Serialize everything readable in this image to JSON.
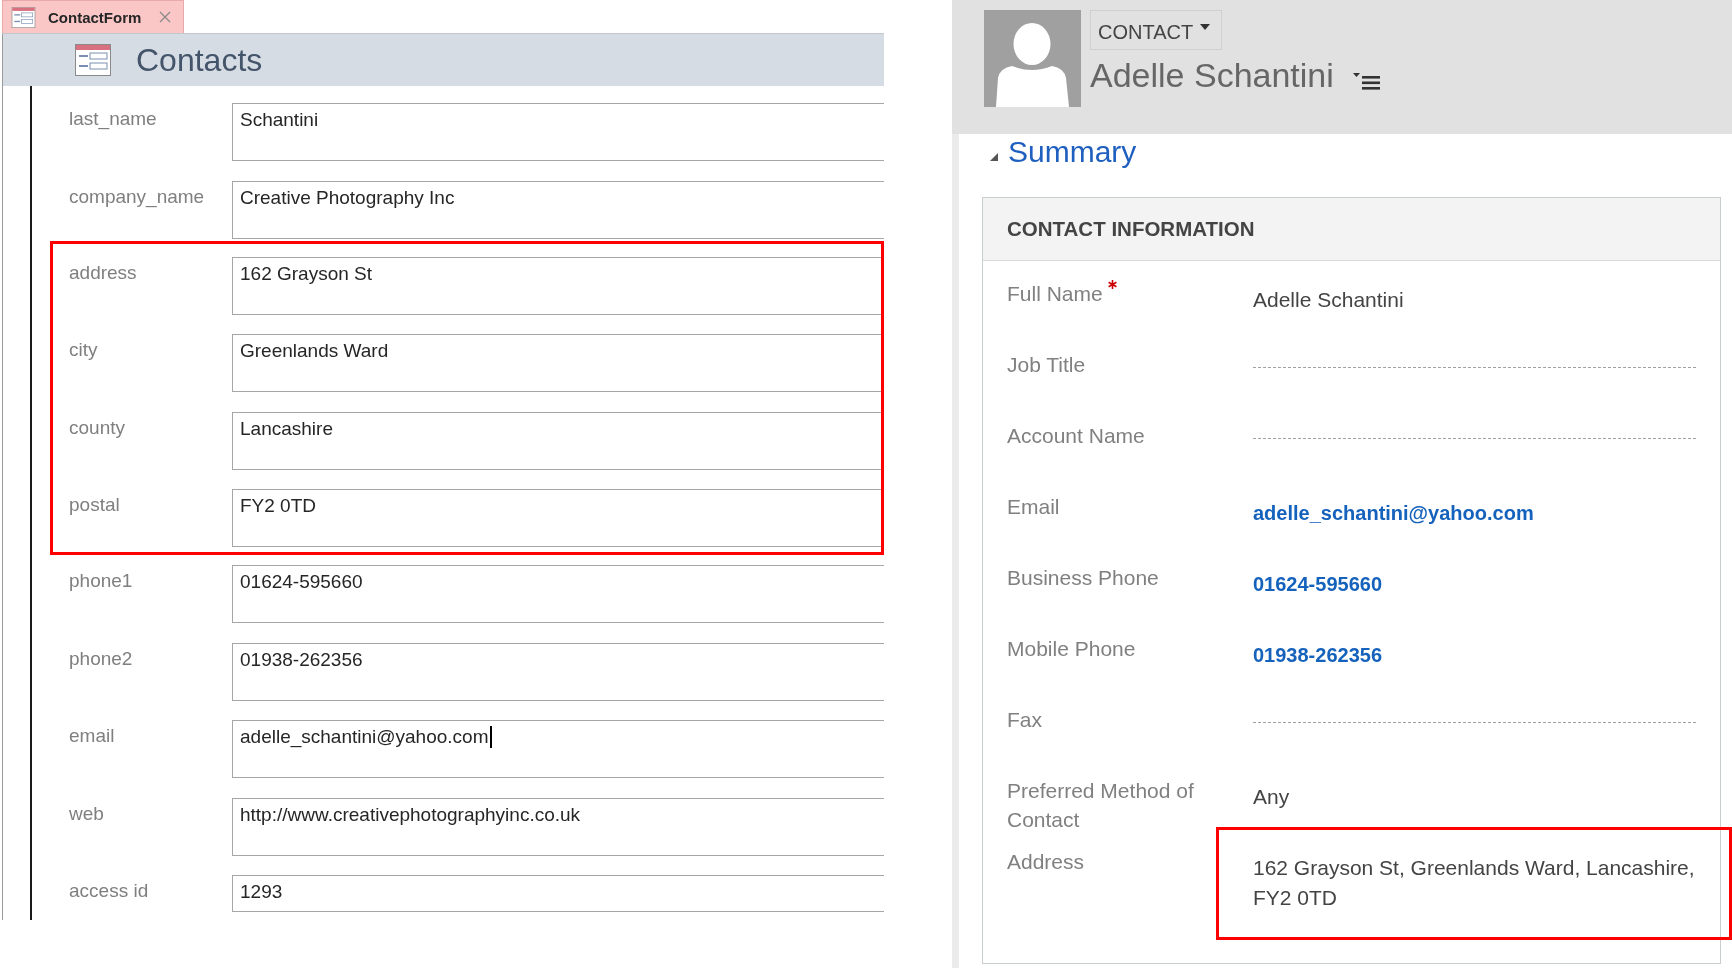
{
  "document_tab": {
    "title": "ContactForm",
    "selected": true
  },
  "form": {
    "title": "Contacts",
    "sections": [
      {
        "highlighted": false,
        "fields": [
          {
            "label": "last_name",
            "value": "Schantini",
            "kind": "multi_line",
            "focused": false
          },
          {
            "label": "company_name",
            "value": "Creative Photography Inc",
            "kind": "multi_line",
            "focused": false
          }
        ]
      },
      {
        "highlighted": true,
        "fields": [
          {
            "label": "address",
            "value": "162 Grayson St",
            "kind": "multi_line",
            "focused": false
          },
          {
            "label": "city",
            "value": "Greenlands Ward",
            "kind": "multi_line",
            "focused": false
          },
          {
            "label": "county",
            "value": "Lancashire",
            "kind": "multi_line",
            "focused": false
          },
          {
            "label": "postal",
            "value": "FY2 0TD",
            "kind": "multi_line",
            "focused": false
          }
        ]
      },
      {
        "highlighted": false,
        "fields": [
          {
            "label": "phone1",
            "value": "01624-595660",
            "kind": "multi_line",
            "focused": false
          },
          {
            "label": "phone2",
            "value": "01938-262356",
            "kind": "multi_line",
            "focused": false
          },
          {
            "label": "email",
            "value": "adelle_schantini@yahoo.com",
            "kind": "multi_line",
            "focused": true
          },
          {
            "label": "web",
            "value": "http://www.creativephotographyinc.co.uk",
            "kind": "multi_line",
            "focused": false
          },
          {
            "label": "access id",
            "value": "1293",
            "kind": "single_line",
            "focused": false
          }
        ]
      }
    ]
  },
  "record": {
    "entity_type": "CONTACT",
    "name": "Adelle Schantini",
    "summary": {
      "title": "Summary",
      "expanded": true,
      "section_title": "CONTACT INFORMATION",
      "rows": [
        {
          "label": "Full Name",
          "required": true,
          "kind": "text",
          "value": "Adelle Schantini",
          "highlighted": false
        },
        {
          "label": "Job Title",
          "required": false,
          "kind": "empty",
          "highlighted": false
        },
        {
          "label": "Account Name",
          "required": false,
          "kind": "empty",
          "highlighted": false
        },
        {
          "label": "Email",
          "required": false,
          "kind": "link",
          "value": "adelle_schantini@yahoo.com",
          "highlighted": false
        },
        {
          "label": "Business Phone",
          "required": false,
          "kind": "link",
          "value": "01624-595660",
          "highlighted": false
        },
        {
          "label": "Mobile Phone",
          "required": false,
          "kind": "link",
          "value": "01938-262356",
          "highlighted": false
        },
        {
          "label": "Fax",
          "required": false,
          "kind": "empty",
          "highlighted": false
        },
        {
          "label": "Preferred Method of Contact",
          "required": false,
          "kind": "text",
          "value": "Any",
          "highlighted": false
        },
        {
          "label": "Address",
          "required": false,
          "kind": "text",
          "value": "162 Grayson St, Greenlands Ward, Lancashire, FY2 0TD",
          "highlighted": true
        }
      ]
    }
  }
}
